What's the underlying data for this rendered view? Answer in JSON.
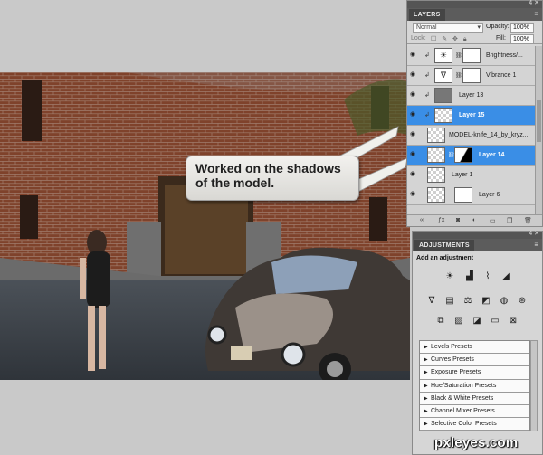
{
  "callout": {
    "text": "Worked on the shadows\nof the model."
  },
  "layers_panel": {
    "tab": "LAYERS",
    "title_controls": "4 ✕",
    "menu_icon": "≡",
    "blend_mode": "Normal",
    "opacity_label": "Opacity:",
    "opacity_value": "100%",
    "lock_label": "Lock:",
    "fill_label": "Fill:",
    "fill_value": "100%",
    "layers": [
      {
        "name": "Brightness/...",
        "thumb": "adj",
        "icon": "☀",
        "selected": false
      },
      {
        "name": "Vibrance 1",
        "thumb": "adj",
        "icon": "∇",
        "selected": false
      },
      {
        "name": "Layer 13",
        "thumb": "gray",
        "selected": false
      },
      {
        "name": "Layer 15",
        "thumb": "checker",
        "selected": true
      },
      {
        "name": "MODEL-knife_14_by_kryz...",
        "thumb": "checker",
        "selected": false
      },
      {
        "name": "Layer 14",
        "thumb": "checker",
        "selected": true
      },
      {
        "name": "Layer 1",
        "thumb": "checker",
        "selected": false
      },
      {
        "name": "Layer 6",
        "thumb": "checker",
        "selected": false
      }
    ]
  },
  "adjustments_panel": {
    "tab": "ADJUSTMENTS",
    "title_controls": "4 ✕",
    "menu_icon": "≡",
    "subtitle": "Add an adjustment",
    "presets": [
      "Levels Presets",
      "Curves Presets",
      "Exposure Presets",
      "Hue/Saturation Presets",
      "Black & White Presets",
      "Channel Mixer Presets",
      "Selective Color Presets"
    ]
  },
  "watermark": "pxleyes.com",
  "colors": {
    "selected_row": "#3a8ee6",
    "panel_bg": "#d6d6d6",
    "panel_header": "#555555"
  }
}
